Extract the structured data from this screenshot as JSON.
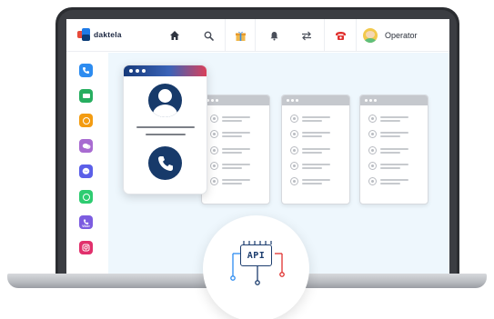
{
  "app": {
    "logo_text": "daktela"
  },
  "topbar": {
    "items": [
      {
        "name": "home-icon",
        "glyph": "⌂",
        "color": "#2f3440"
      },
      {
        "name": "search-icon",
        "glyph": "⌕",
        "color": "#4a4f5a"
      },
      {
        "name": "gift-icon",
        "glyph": "🎁",
        "color": "#e6a23c"
      },
      {
        "name": "bell-icon",
        "glyph": "🔔",
        "color": "#4a4f5a"
      },
      {
        "name": "transfer-icon",
        "glyph": "⇄",
        "color": "#4a4f5a"
      },
      {
        "name": "phone-red-icon",
        "glyph": "☎",
        "color": "#e0312f"
      }
    ],
    "operator_label": "Operator"
  },
  "sidebar": {
    "channels": [
      {
        "name": "phone-channel-icon",
        "color": "#2d8cf0"
      },
      {
        "name": "email-channel-icon",
        "color": "#27ae60"
      },
      {
        "name": "chat-channel-icon",
        "color": "#f39c12"
      },
      {
        "name": "messages-channel-icon",
        "color": "#9b59b6"
      },
      {
        "name": "messenger-channel-icon",
        "color": "#5b5fe8"
      },
      {
        "name": "whatsapp-channel-icon",
        "color": "#2ecc71"
      },
      {
        "name": "viber-channel-icon",
        "color": "#7c5ce0",
        "label": "Viber"
      },
      {
        "name": "instagram-channel-icon",
        "color": "#e1306c"
      }
    ]
  },
  "api_badge": {
    "label": "API",
    "colors": {
      "primary": "#1c3d6e",
      "left": "#2d8cf0",
      "right": "#e0312f",
      "middle": "#1c3d6e"
    }
  }
}
